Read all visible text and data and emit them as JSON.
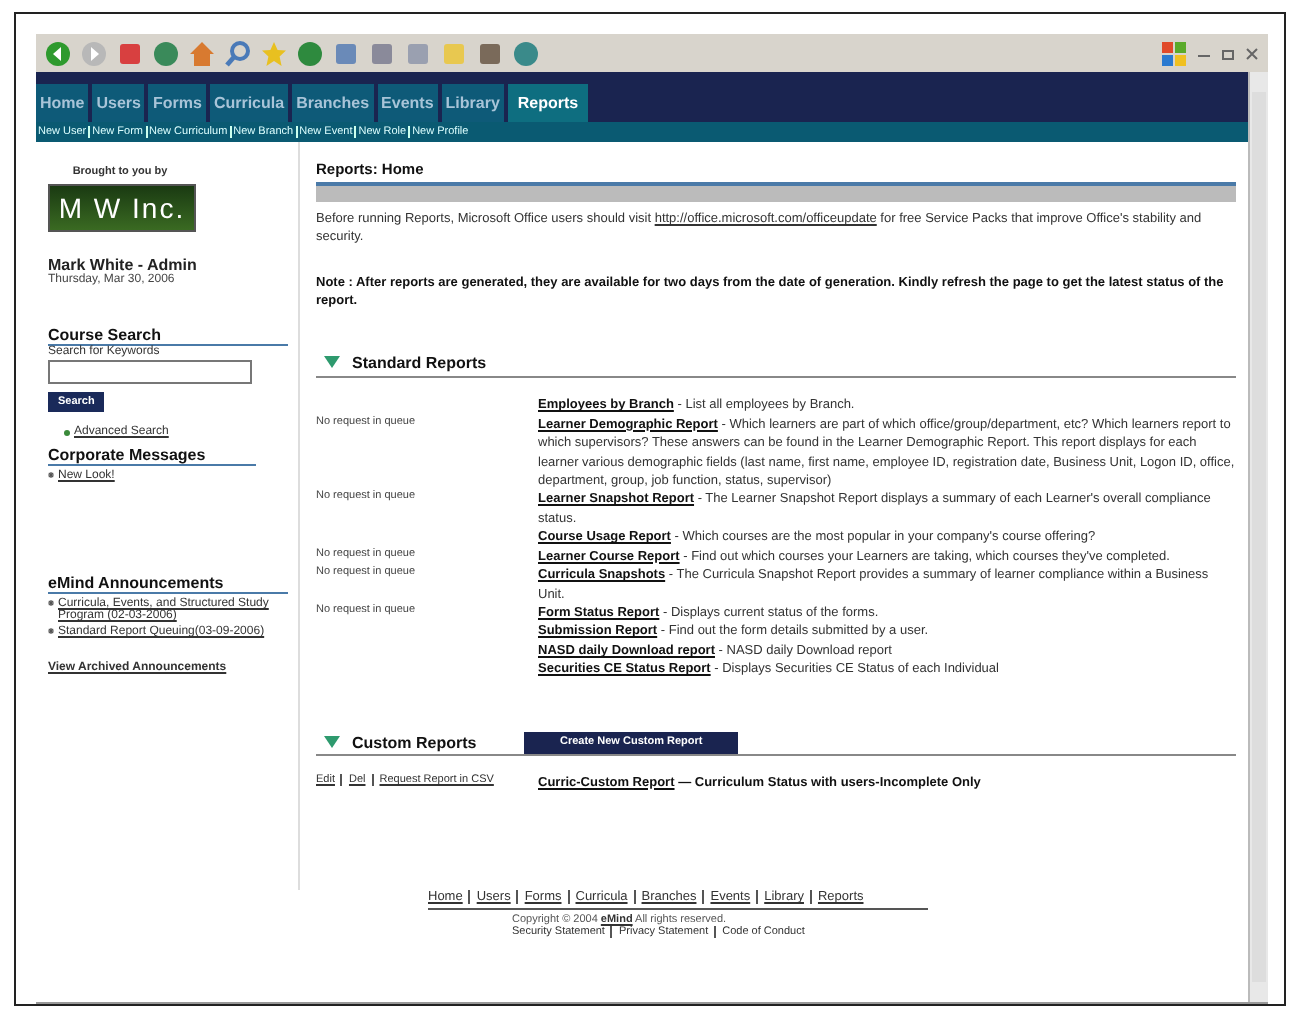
{
  "nav": {
    "tabs": [
      {
        "label": "Home",
        "selected": false
      },
      {
        "label": "Users",
        "selected": false
      },
      {
        "label": "Forms",
        "selected": false
      },
      {
        "label": "Curricula",
        "selected": false
      },
      {
        "label": "Branches",
        "selected": false
      },
      {
        "label": "Events",
        "selected": false
      },
      {
        "label": "Library",
        "selected": false
      },
      {
        "label": "Reports",
        "selected": true
      }
    ],
    "sublinks": [
      "New User",
      "New Form",
      "New Curriculum",
      "New Branch",
      "New Event",
      "New Role",
      "New Profile"
    ]
  },
  "sidebar": {
    "sponsor_caption": "Brought to you by",
    "logo": "M W Inc.",
    "user": "Mark White - Admin",
    "date": "Thursday, Mar 30, 2006",
    "course_search": {
      "title": "Course Search",
      "label": "Search for Keywords",
      "button": "Search",
      "advanced_link": "Advanced Search"
    },
    "corporate_messages": {
      "title": "Corporate Messages",
      "items": [
        "New Look!"
      ]
    },
    "announcements": {
      "title": "eMind  Announcements",
      "items": [
        "Curricula, Events, and Structured Study Program (02-03-2006)",
        "Standard Report Queuing(03-09-2006)"
      ],
      "archive_link": "View Archived Announcements"
    }
  },
  "main": {
    "title": "Reports: Home",
    "intro_before": "Before running Reports, Microsoft Office users should visit",
    "intro_link": "http://office.microsoft.com/officeupdate",
    "intro_after": "for free Service Packs that improve Office's stability and security.",
    "note": "Note : After reports are generated, they are available for two days from the date of generation. Kindly refresh the page to get the latest status of the report.",
    "standard_reports": {
      "title": "Standard Reports",
      "expanded": true,
      "rows": [
        {
          "queue": "",
          "name": "Employees by Branch",
          "description": "- List all employees by Branch."
        },
        {
          "queue": "No request in queue",
          "name": "Learner Demographic Report",
          "description": "- Which learners are part of which office/group/department, etc? Which learners report to which supervisors? These answers can be found in the Learner Demographic Report. This report displays for each learner various demographic fields (last name, first name, employee ID, registration date, Business Unit, Logon ID, office, department, group, job function, status, supervisor)"
        },
        {
          "queue": "No request in queue",
          "name": "Learner Snapshot Report",
          "description": "- The Learner Snapshot Report displays a summary of each Learner's overall compliance status."
        },
        {
          "queue": "",
          "name": "Course Usage Report",
          "description": "- Which courses are the most popular in your company's course offering?"
        },
        {
          "queue": "No request in queue",
          "name": "Learner Course Report",
          "description": "- Find out which courses your Learners are taking, which courses they've completed."
        },
        {
          "queue": "No request in queue",
          "name": "Curricula Snapshots",
          "description": "- The Curricula Snapshot Report provides a summary of learner compliance within a Business Unit."
        },
        {
          "queue": "No request in queue",
          "name": "Form Status Report",
          "description": "- Displays current status of the forms."
        },
        {
          "queue": "",
          "name": "Submission Report",
          "description": "- Find out the form details submitted by a user."
        },
        {
          "queue": "",
          "name": "NASD daily Download report",
          "description": "- NASD daily Download report"
        },
        {
          "queue": "",
          "name": "Securities CE Status Report",
          "description": "- Displays Securities CE Status of each Individual"
        }
      ]
    },
    "custom_reports": {
      "title": "Custom Reports",
      "expanded": true,
      "create_button": "Create New Custom Report",
      "rows": [
        {
          "actions": [
            "Edit",
            "Del",
            "Request Report in CSV"
          ],
          "name": "Curric-Custom Report",
          "description": "— Curriculum Status with users-Incomplete Only"
        }
      ]
    }
  },
  "footer": {
    "links": [
      "Home",
      "Users",
      "Forms",
      "Curricula",
      "Branches",
      "Events",
      "Library",
      "Reports"
    ],
    "copyright_before": "Copyright © 2004",
    "copyright_link": "eMind",
    "copyright_after": "All rights reserved.",
    "policy_links": [
      "Security Statement",
      "Privacy Statement",
      "Code of Conduct"
    ]
  }
}
